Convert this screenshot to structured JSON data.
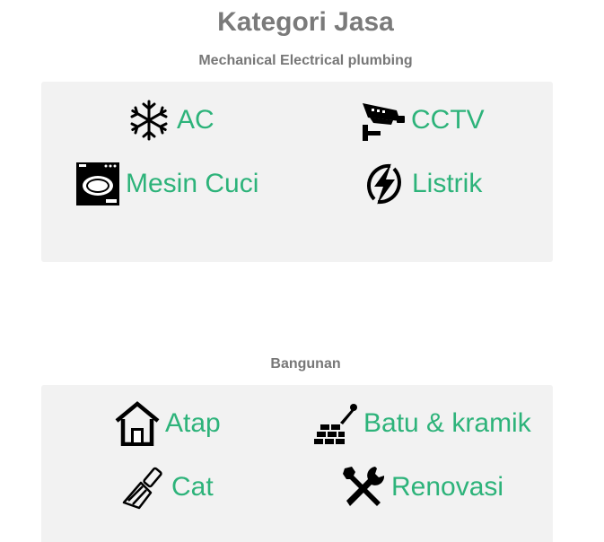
{
  "page": {
    "title": "Kategori Jasa"
  },
  "sections": [
    {
      "title": "Mechanical Electrical plumbing",
      "items": [
        {
          "label": "AC",
          "icon": "snowflake-icon"
        },
        {
          "label": "CCTV",
          "icon": "cctv-camera-icon"
        },
        {
          "label": "Mesin Cuci",
          "icon": "washing-machine-icon"
        },
        {
          "label": "Listrik",
          "icon": "lightning-icon"
        }
      ]
    },
    {
      "title": "Bangunan",
      "items": [
        {
          "label": "Atap",
          "icon": "house-roof-icon"
        },
        {
          "label": "Batu & kramik",
          "icon": "bricks-trowel-icon"
        },
        {
          "label": "Cat",
          "icon": "paint-brush-icon"
        },
        {
          "label": "Renovasi",
          "icon": "wrench-screwdriver-icon"
        }
      ]
    }
  ],
  "colors": {
    "link": "#2db37a",
    "heading": "#7a7a7a",
    "panel_bg": "#f2f2f2"
  }
}
